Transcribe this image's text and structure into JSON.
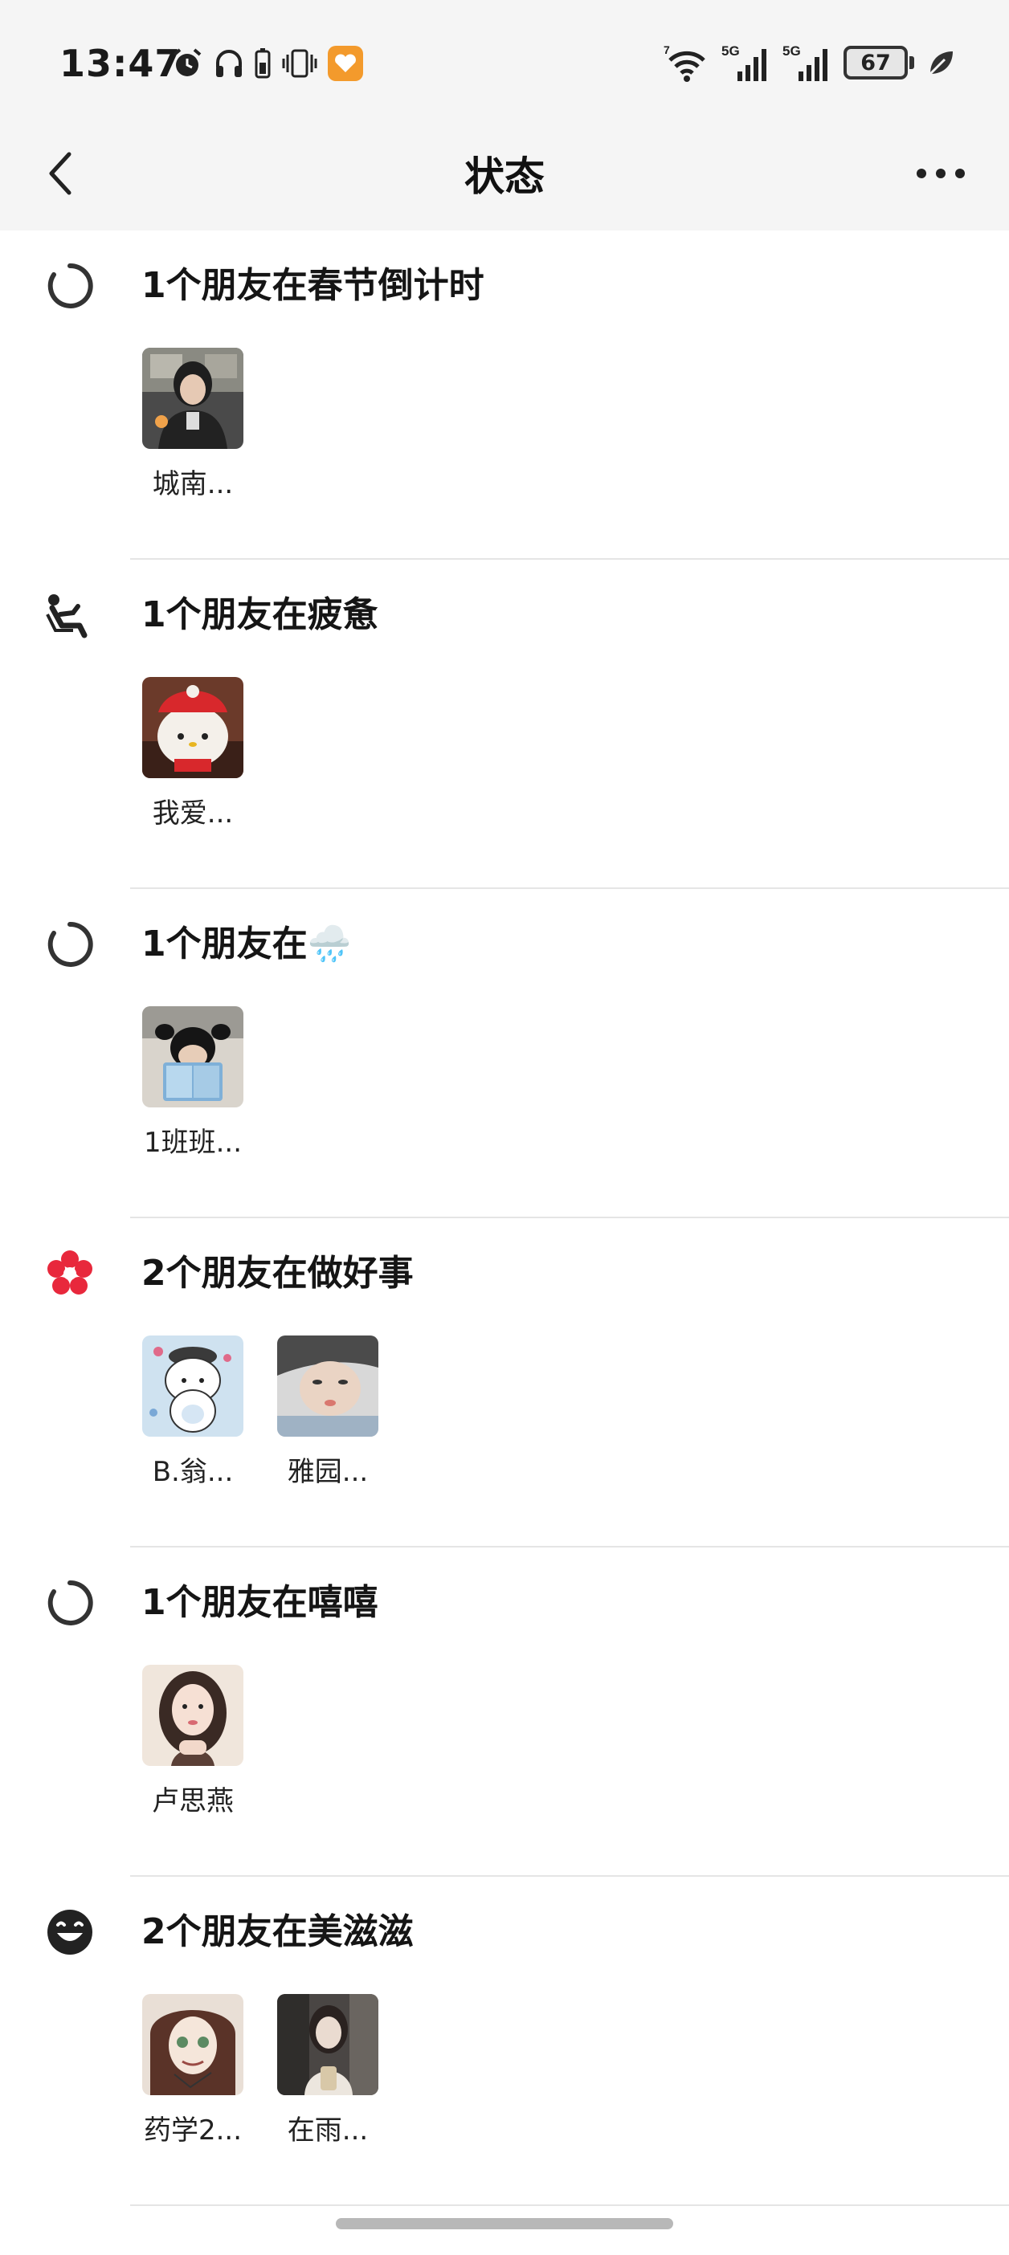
{
  "status_bar": {
    "time": "13:47",
    "battery": "67",
    "left_icons": [
      "alarm-icon",
      "headset-icon",
      "phone-battery-icon",
      "vibrate-icon",
      "heart-app-icon"
    ],
    "right_icons": [
      "wifi-icon",
      "signal-5g-1-icon",
      "signal-5g-2-icon",
      "battery-icon",
      "leaf-icon"
    ],
    "network_labels": [
      "7",
      "5G",
      "5G"
    ]
  },
  "header": {
    "title": "状态"
  },
  "sections": [
    {
      "title": "1个朋友在春节倒计时",
      "icon": "loading-ring-icon",
      "friends": [
        {
          "name": "城南..."
        }
      ]
    },
    {
      "title": "1个朋友在疲惫",
      "icon": "reclining-person-icon",
      "friends": [
        {
          "name": "我爱..."
        }
      ]
    },
    {
      "title": "1个朋友在🌧️",
      "icon": "loading-ring-icon",
      "friends": [
        {
          "name": "1班班..."
        }
      ]
    },
    {
      "title": "2个朋友在做好事",
      "icon": "red-flower-icon",
      "friends": [
        {
          "name": "B.翁..."
        },
        {
          "name": "雅园..."
        }
      ]
    },
    {
      "title": "1个朋友在嘻嘻",
      "icon": "loading-ring-icon",
      "friends": [
        {
          "name": "卢思燕"
        }
      ]
    },
    {
      "title": "2个朋友在美滋滋",
      "icon": "smiley-face-icon",
      "friends": [
        {
          "name": "药学2..."
        },
        {
          "name": "在雨..."
        }
      ]
    }
  ],
  "colors": {
    "header_bg": "#f5f5f5",
    "flower_red": "#e8283c",
    "divider": "#e5e5e5"
  }
}
